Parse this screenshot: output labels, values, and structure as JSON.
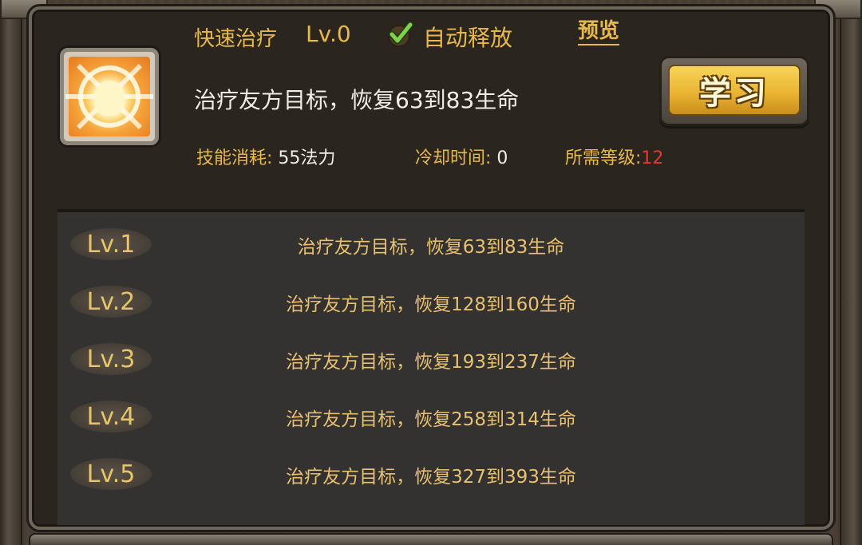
{
  "skill": {
    "name": "快速治疗",
    "level": "Lv.0",
    "auto_release_label": "自动释放",
    "auto_release_checked": true,
    "preview_label": "预览",
    "description": "治疗友方目标，恢复63到83生命",
    "learn_button_label": "学习",
    "icon_name": "healing-hand-icon"
  },
  "stats": {
    "cost_label": "技能消耗:",
    "cost_value": " 55法力",
    "cooldown_label": "冷却时间:",
    "cooldown_value": " 0",
    "required_level_label": "所需等级:",
    "required_level_value": "12"
  },
  "levels": [
    {
      "level": "Lv.1",
      "description": "治疗友方目标，恢复63到83生命"
    },
    {
      "level": "Lv.2",
      "description": "治疗友方目标，恢复128到160生命"
    },
    {
      "level": "Lv.3",
      "description": "治疗友方目标，恢复193到237生命"
    },
    {
      "level": "Lv.4",
      "description": "治疗友方目标，恢复258到314生命"
    },
    {
      "level": "Lv.5",
      "description": "治疗友方目标，恢复327到393生命"
    }
  ],
  "colors": {
    "gold_text": "#e8b94a",
    "white_text": "#f2eee6",
    "red_text": "#e23a2a",
    "button_gold": "#eab533"
  }
}
